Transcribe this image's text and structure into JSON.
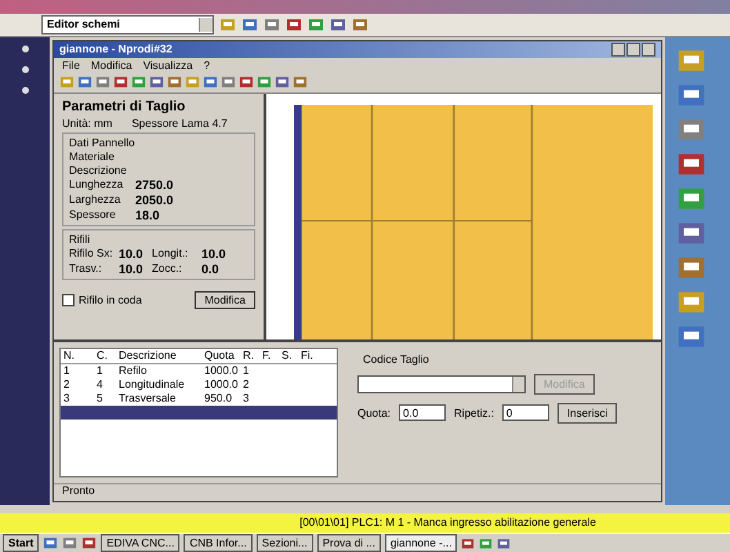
{
  "app_toolbar": {
    "editor_select": "Editor schemi"
  },
  "window": {
    "title": "giannone - Nprodi#32",
    "menu": [
      "File",
      "Modifica",
      "Visualizza",
      "?"
    ]
  },
  "params": {
    "title": "Parametri di Taglio",
    "unit": "Unità: mm",
    "blade": "Spessore Lama 4.7",
    "panel_group": "Dati Pannello",
    "panel_fields": [
      {
        "label": "Materiale"
      },
      {
        "label": "Descrizione"
      },
      {
        "label": "Lunghezza",
        "value": "2750.0"
      },
      {
        "label": "Larghezza",
        "value": "2050.0"
      },
      {
        "label": "Spessore",
        "value": "18.0"
      }
    ],
    "trim_group": "Rifili",
    "trims": [
      {
        "label": "Rifilo Sx:",
        "value": "10.0"
      },
      {
        "label": "Longit.:",
        "value": "10.0"
      },
      {
        "label": "Trasv.:",
        "value": "10.0"
      },
      {
        "label": "Zocc.:",
        "value": "0.0"
      }
    ],
    "tail_trim": {
      "label": "Rifilo in coda",
      "checked": false
    },
    "modify_button": "Modifica"
  },
  "cut_table": {
    "columns": [
      "N.",
      "C.",
      "Descrizione",
      "Quota",
      "R.",
      "F.",
      "S.",
      "Fi."
    ],
    "rows": [
      {
        "cells": [
          "1",
          "1",
          "Refilo",
          "1000.0",
          "1",
          null,
          null,
          null
        ],
        "selected": false
      },
      {
        "cells": [
          "2",
          "4",
          "Longitudinale",
          "1000.0",
          "2",
          null,
          null,
          null
        ],
        "selected": false
      },
      {
        "cells": [
          "3",
          "5",
          "Trasversale",
          "950.0",
          "3",
          null,
          null,
          null
        ],
        "selected": false
      },
      {
        "cells": [
          null,
          null,
          null,
          null,
          null,
          null,
          null,
          null
        ],
        "selected": true
      }
    ]
  },
  "cut_form": {
    "code_label": "Codice Taglio",
    "edit_button": {
      "label": "Modifica",
      "disabled": true
    },
    "quota_label": "Quota:",
    "quota_value": "0.0",
    "repeat_label": "Ripetiz.:",
    "repeat_value": "0",
    "insert_button": {
      "label": "Inserisci",
      "disabled": false
    }
  },
  "window_status": "Pronto",
  "alarm_bar": "[00\\01\\01] PLC1: M 1 - Manca ingresso abilitazione generale",
  "taskbar": {
    "start": "Start",
    "tasks": [
      {
        "label": "EDIVA CNC...",
        "selected": false
      },
      {
        "label": "CNB Infor...",
        "selected": false
      },
      {
        "label": "Sezioni...",
        "selected": false
      },
      {
        "label": "Prova di ...",
        "selected": false
      },
      {
        "label": "giannone -...",
        "selected": true
      }
    ]
  }
}
